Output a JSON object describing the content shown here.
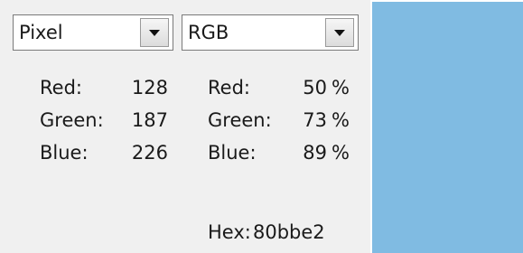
{
  "unit_selector": {
    "selected": "Pixel"
  },
  "mode_selector": {
    "selected": "RGB"
  },
  "pixel_values": [
    {
      "label": "Red:",
      "value": "128"
    },
    {
      "label": "Green:",
      "value": "187"
    },
    {
      "label": "Blue:",
      "value": "226"
    }
  ],
  "percent_values": [
    {
      "label": "Red:",
      "value": "50",
      "unit": "%"
    },
    {
      "label": "Green:",
      "value": "73",
      "unit": "%"
    },
    {
      "label": "Blue:",
      "value": "89",
      "unit": "%"
    }
  ],
  "hex": {
    "label": "Hex:",
    "value": "80bbe2"
  },
  "swatch": {
    "color": "#80bbe2",
    "icon": "color-swatch"
  },
  "colors": {
    "background": "#f0f0f0",
    "swatch": "#80bbe2"
  }
}
